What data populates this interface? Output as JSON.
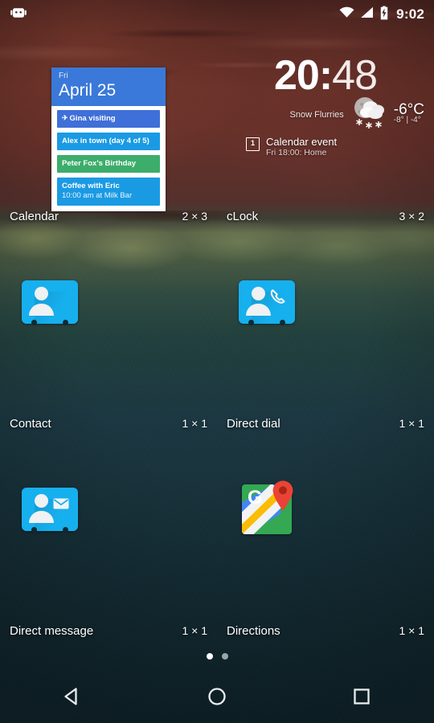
{
  "status_bar": {
    "left_icon": "android-bugdroid-icon",
    "icons": [
      "wifi-icon",
      "cellular-signal-icon",
      "battery-charging-icon"
    ],
    "clock": "9:02"
  },
  "calendar_widget": {
    "day_of_week": "Fri",
    "date": "April 25",
    "header_color": "#3a79d9",
    "events": [
      {
        "title": "Gina visiting",
        "sub": "",
        "color": "#3f6fd8",
        "icon": "✈"
      },
      {
        "title": "Alex in town (day 4 of 5)",
        "sub": "",
        "color": "#1b9ae4",
        "icon": ""
      },
      {
        "title": "Peter Fox’s Birthday",
        "sub": "",
        "color": "#3cad6b",
        "icon": ""
      },
      {
        "title": "Coffee with Eric",
        "sub": "10:00 am at Milk Bar",
        "color": "#1b9ae4",
        "icon": ""
      }
    ]
  },
  "clock_widget": {
    "hours": "20",
    "colon": ":",
    "minutes": "48",
    "condition": "Snow Flurries",
    "temp_now": "-6°C",
    "temp_high_low": "-8° | -4°",
    "weather_icon": "moon-cloud-snow-icon",
    "event_icon": "calendar-day-icon",
    "event_icon_day": "1",
    "event_title": "Calendar event",
    "event_sub": "Fri 18:00: Home"
  },
  "widget_list": [
    {
      "name": "Calendar",
      "size": "2 × 3",
      "icon": "calendar-widget-preview"
    },
    {
      "name": "cLock",
      "size": "3 × 2",
      "icon": "clock-widget-preview"
    },
    {
      "name": "Contact",
      "size": "1 × 1",
      "icon": "contact-card-icon"
    },
    {
      "name": "Direct dial",
      "size": "1 × 1",
      "icon": "contact-phone-icon"
    },
    {
      "name": "Direct message",
      "size": "1 × 1",
      "icon": "contact-mail-icon"
    },
    {
      "name": "Directions",
      "size": "1 × 1",
      "icon": "google-maps-icon"
    }
  ],
  "page_indicator": {
    "count": 2,
    "active_index": 0
  },
  "nav_bar": {
    "back": "back-triangle-icon",
    "home": "home-circle-icon",
    "recents": "recents-square-icon"
  },
  "colors": {
    "accent_blue": "#16b0ef",
    "calendar_blue": "#3a79d9",
    "maps_green": "#34a853",
    "maps_blue": "#4285f4",
    "maps_yellow": "#fbbc04",
    "maps_red": "#ea4335"
  }
}
